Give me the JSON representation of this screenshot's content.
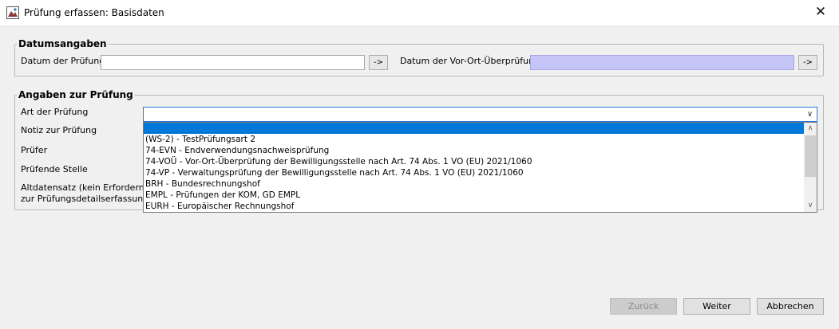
{
  "window": {
    "title": "Prüfung erfassen: Basisdaten",
    "close_glyph": "✕"
  },
  "datumsangaben": {
    "legend": "Datumsangaben",
    "datum_pruefung_label": "Datum der Prüfung",
    "datum_pruefung_value": "",
    "datum_pruefung_button": "->",
    "datum_vorort_label": "Datum der Vor-Ort-Überprüfung",
    "datum_vorort_value": "",
    "datum_vorort_button": "->"
  },
  "angaben": {
    "legend": "Angaben zur Prüfung",
    "art_label": "Art der Prüfung",
    "art_value": "",
    "notiz_label": "Notiz zur Prüfung",
    "pruefer_label": "Prüfer",
    "stelle_label": "Prüfende Stelle",
    "altdaten_label_line1": "Altdatensatz (kein Erfordernis",
    "altdaten_label_line2": "zur Prüfungsdetailserfassung)"
  },
  "dropdown": {
    "options": [
      "",
      "(WS-2) - TestPrüfungsart 2",
      "74-EVN - Endverwendungsnachweisprüfung",
      "74-VOÜ - Vor-Ort-Überprüfung der Bewilligungsstelle nach Art. 74 Abs. 1 VO (EU) 2021/1060",
      "74-VP - Verwaltungsprüfung der Bewilligungsstelle nach Art. 74 Abs. 1 VO (EU) 2021/1060",
      "BRH - Bundesrechnungshof",
      "EMPL - Prüfungen der KOM, GD EMPL",
      "EURH - Europäischer Rechnungshof"
    ]
  },
  "buttons": {
    "zurueck": "Zurück",
    "weiter": "Weiter",
    "abbrechen": "Abbrechen"
  },
  "colors": {
    "accent": "#0078d7",
    "disabled_field": "#c5c5f7"
  }
}
